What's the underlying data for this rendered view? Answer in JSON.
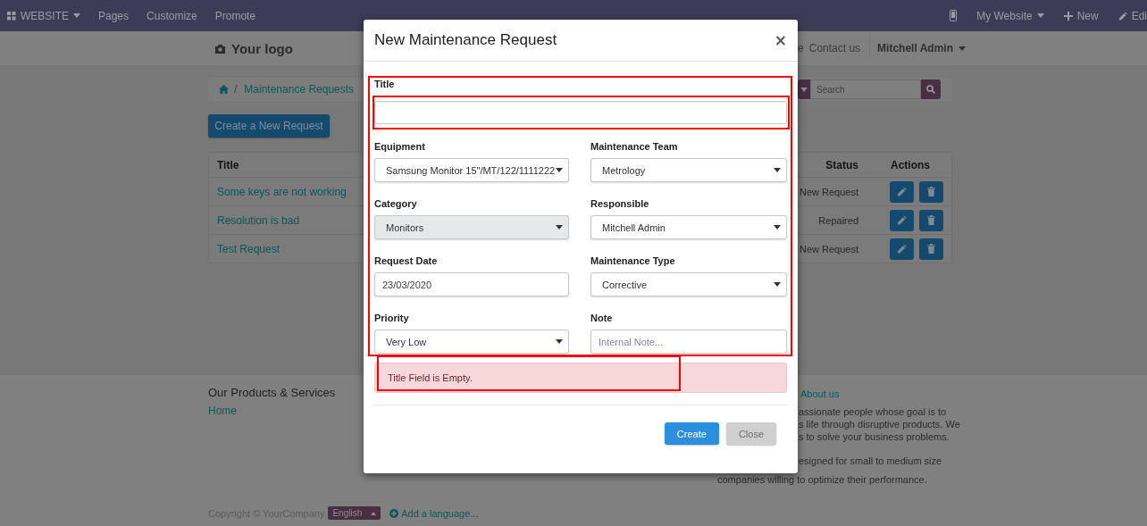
{
  "topbar": {
    "app_menu": "WEBSITE",
    "links": [
      "Pages",
      "Customize",
      "Promote"
    ],
    "right": [
      {
        "kind": "device"
      },
      {
        "kind": "menu",
        "label": "My Website"
      },
      {
        "kind": "new",
        "label": "New"
      },
      {
        "kind": "edit",
        "label": "Edi"
      }
    ]
  },
  "header": {
    "logo": "Your logo",
    "nav_links": [
      "e",
      "Contact us"
    ],
    "user": "Mitchell Admin"
  },
  "breadcrumb": {
    "separator": "/",
    "items": [
      "Maintenance Requests"
    ],
    "search": {
      "placeholder": "Search"
    }
  },
  "create_button": "Create a New Request",
  "table": {
    "columns": [
      "Title",
      "Status",
      "Actions"
    ],
    "rows": [
      {
        "title": "Some keys are not working",
        "status": "New Request"
      },
      {
        "title": "Resolution is bad",
        "status": "Repaired"
      },
      {
        "title": "Test Request",
        "status": "New Request"
      }
    ]
  },
  "footer": {
    "products": {
      "heading": "Our Products & Services",
      "links": [
        "Home"
      ]
    },
    "about": {
      "heading": "About us",
      "lines": [
        "assionate people whose goal is to",
        "s life through disruptive products. We",
        "s to solve your business problems."
      ],
      "lines_2": [
        "esigned for small to medium size"
      ],
      "full_lines": [
        "companies willing to optimize their performance."
      ]
    },
    "copyright": "Copyright © YourCompany",
    "language": "English",
    "add_language": "Add a language..."
  },
  "modal": {
    "title": "New Maintenance Request",
    "close_label": "×",
    "title_field": {
      "label": "Title"
    },
    "fields": [
      {
        "label": "Equipment",
        "kind": "select",
        "value": "Samsung Monitor 15\"/MT/122/1111222",
        "disabled": false
      },
      {
        "label": "Maintenance Team",
        "kind": "select",
        "value": "Metrology",
        "disabled": false
      },
      {
        "label": "Category",
        "kind": "select",
        "value": "Monitors",
        "disabled": true
      },
      {
        "label": "Responsible",
        "kind": "select",
        "value": "Mitchell Admin",
        "disabled": false
      },
      {
        "label": "Request Date",
        "kind": "input",
        "value": "23/03/2020",
        "disabled": false
      },
      {
        "label": "Maintenance Type",
        "kind": "select",
        "value": "Corrective",
        "disabled": false
      },
      {
        "label": "Priority",
        "kind": "select",
        "value": "Very Low",
        "disabled": false
      },
      {
        "label": "Note",
        "kind": "input",
        "placeholder": "Internal Note...",
        "disabled": false
      }
    ],
    "alert": "Title Field is Empty.",
    "buttons": [
      {
        "label": "Create",
        "kind": "primary",
        "disabled": false
      },
      {
        "label": "Close",
        "kind": "secondary",
        "disabled": true
      }
    ]
  }
}
